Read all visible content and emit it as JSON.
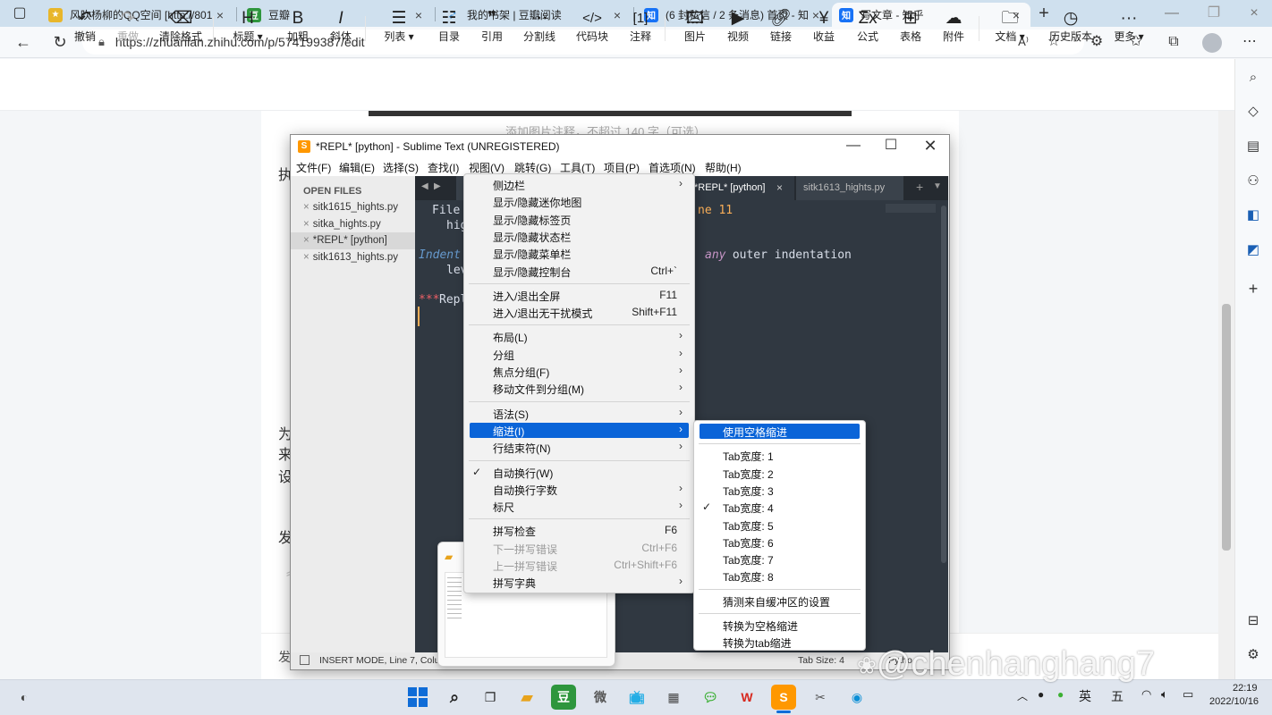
{
  "browser": {
    "tabs": [
      {
        "title": "风吹杨柳的QQ空间 [http://8016",
        "icon_color": "#e8b62a",
        "icon": "star-icon"
      },
      {
        "title": "豆瓣",
        "icon_color": "#2e963d",
        "icon_text": "豆"
      },
      {
        "title": "我的书架 | 豆瓣阅读",
        "icon_color": "#3d8fd4",
        "icon": "bird-icon"
      },
      {
        "title": "(6 封私信 / 2 条消息) 首页 - 知乎",
        "icon_color": "#1772f6",
        "icon_text": "知"
      },
      {
        "title": "写文章 - 知乎",
        "icon_color": "#1772f6",
        "icon_text": "知"
      }
    ],
    "url": "https://zhuanlan.zhihu.com/p/574199387/edit"
  },
  "toolbar": {
    "undo": "撤销",
    "redo": "重做",
    "clear_format": "清除格式",
    "heading": "标题",
    "bold": "加粗",
    "italic": "斜体",
    "list": "列表",
    "toc": "目录",
    "quote": "引用",
    "divider": "分割线",
    "code_block": "代码块",
    "comment": "注释",
    "image": "图片",
    "video": "视频",
    "link": "链接",
    "income": "收益",
    "formula": "公式",
    "table": "表格",
    "attachment": "附件",
    "document": "文档",
    "history": "历史版本",
    "more": "更多"
  },
  "page": {
    "caption_hint": "添加图片注释，不超过 140 字（可选）",
    "chars": [
      "执",
      "为",
      "来",
      "设",
      "发",
      "发"
    ]
  },
  "sublime": {
    "title": "*REPL* [python] - Sublime Text (UNREGISTERED)",
    "menu": [
      "文件(F)",
      "编辑(E)",
      "选择(S)",
      "查找(I)",
      "视图(V)",
      "跳转(G)",
      "工具(T)",
      "项目(P)",
      "首选项(N)",
      "帮助(H)"
    ],
    "open_files_header": "OPEN FILES",
    "open_files": [
      "sitk1615_hights.py",
      "sitka_hights.py",
      "*REPL* [python]",
      "sitk1613_hights.py"
    ],
    "tabs": [
      "*REPL* [python]",
      "sitk1613_hights.py"
    ],
    "code": {
      "l1a": "File",
      "l1b": "ne 11",
      "l2": "hig",
      "l3a": "Indent",
      "l3b": "any",
      "l3c": " outer indentation",
      "l4": "lev",
      "l5a": "***",
      "l5b": "Repl"
    },
    "status_left": "INSERT MODE, Line 7, Colum",
    "status_tab": "Tab Size: 4",
    "status_syntax": "Pytho"
  },
  "view_menu": {
    "items": [
      {
        "label": "侧边栏",
        "arrow": true
      },
      {
        "label": "显示/隐藏迷你地图"
      },
      {
        "label": "显示/隐藏标签页"
      },
      {
        "label": "显示/隐藏状态栏"
      },
      {
        "label": "显示/隐藏菜单栏"
      },
      {
        "label": "显示/隐藏控制台",
        "shortcut": "Ctrl+`"
      },
      {
        "sep": true
      },
      {
        "label": "进入/退出全屏",
        "shortcut": "F11"
      },
      {
        "label": "进入/退出无干扰模式",
        "shortcut": "Shift+F11"
      },
      {
        "sep": true
      },
      {
        "label": "布局(L)",
        "arrow": true
      },
      {
        "label": "分组",
        "arrow": true
      },
      {
        "label": "焦点分组(F)",
        "arrow": true
      },
      {
        "label": "移动文件到分组(M)",
        "arrow": true
      },
      {
        "sep": true
      },
      {
        "label": "语法(S)",
        "arrow": true
      },
      {
        "label": "缩进(I)",
        "arrow": true,
        "highlight": true
      },
      {
        "label": "行结束符(N)",
        "arrow": true
      },
      {
        "sep": true
      },
      {
        "label": "自动换行(W)",
        "checked": true
      },
      {
        "label": "自动换行字数",
        "arrow": true
      },
      {
        "label": "标尺",
        "arrow": true
      },
      {
        "sep": true
      },
      {
        "label": "拼写检查",
        "shortcut": "F6"
      },
      {
        "label": "下一拼写错误",
        "shortcut": "Ctrl+F6",
        "disabled": true
      },
      {
        "label": "上一拼写错误",
        "shortcut": "Ctrl+Shift+F6",
        "disabled": true
      },
      {
        "label": "拼写字典",
        "arrow": true
      }
    ]
  },
  "indent_menu": {
    "items": [
      {
        "label": "使用空格缩进",
        "highlight": true
      },
      {
        "sep": true
      },
      {
        "label": "Tab宽度: 1"
      },
      {
        "label": "Tab宽度: 2"
      },
      {
        "label": "Tab宽度: 3"
      },
      {
        "label": "Tab宽度: 4",
        "checked": true
      },
      {
        "label": "Tab宽度: 5"
      },
      {
        "label": "Tab宽度: 6"
      },
      {
        "label": "Tab宽度: 7"
      },
      {
        "label": "Tab宽度: 8"
      },
      {
        "sep": true
      },
      {
        "label": "猜测来自缓冲区的设置"
      },
      {
        "sep": true
      },
      {
        "label": "转换为空格缩进"
      },
      {
        "label": "转换为tab缩进"
      }
    ]
  },
  "taskbar": {
    "ime_lang": "英",
    "ime_mode": "五",
    "time": "22:19",
    "date": "2022/10/16"
  },
  "watermark": "@chenhanghang7"
}
